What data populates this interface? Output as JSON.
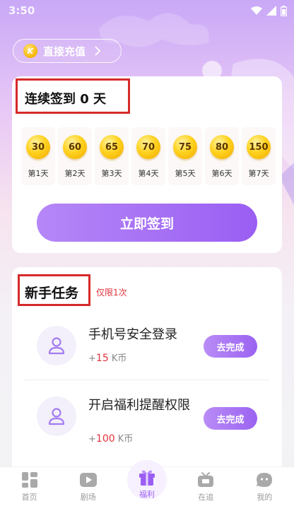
{
  "status_bar": {
    "time": "3:50"
  },
  "recharge": {
    "label": "直接充值",
    "coin_letter": "K"
  },
  "sign_in": {
    "title": "连续签到 0 天",
    "days": [
      {
        "reward": "30",
        "label": "第1天"
      },
      {
        "reward": "60",
        "label": "第2天"
      },
      {
        "reward": "65",
        "label": "第3天"
      },
      {
        "reward": "70",
        "label": "第4天"
      },
      {
        "reward": "75",
        "label": "第5天"
      },
      {
        "reward": "80",
        "label": "第6天"
      },
      {
        "reward": "150",
        "label": "第7天"
      }
    ],
    "button_label": "立即签到"
  },
  "tasks": {
    "title": "新手任务",
    "limit": "仅限1次",
    "items": [
      {
        "name": "手机号安全登录",
        "reward_prefix": "+",
        "reward_amount": "15",
        "reward_unit": "K币",
        "button_label": "去完成"
      },
      {
        "name": "开启福利提醒权限",
        "reward_prefix": "+",
        "reward_amount": "100",
        "reward_unit": "K币",
        "button_label": "去完成"
      }
    ]
  },
  "bottom_nav": {
    "items": [
      {
        "label": "首页",
        "icon": "home-grid-icon"
      },
      {
        "label": "剧场",
        "icon": "play-icon"
      },
      {
        "label": "福利",
        "icon": "gift-icon",
        "active": true
      },
      {
        "label": "在追",
        "icon": "tv-icon"
      },
      {
        "label": "我的",
        "icon": "profile-icon"
      }
    ]
  },
  "colors": {
    "accent": "#9b5ef2",
    "highlight_red": "#e0323a",
    "annotation_box": "#d62a2a"
  }
}
